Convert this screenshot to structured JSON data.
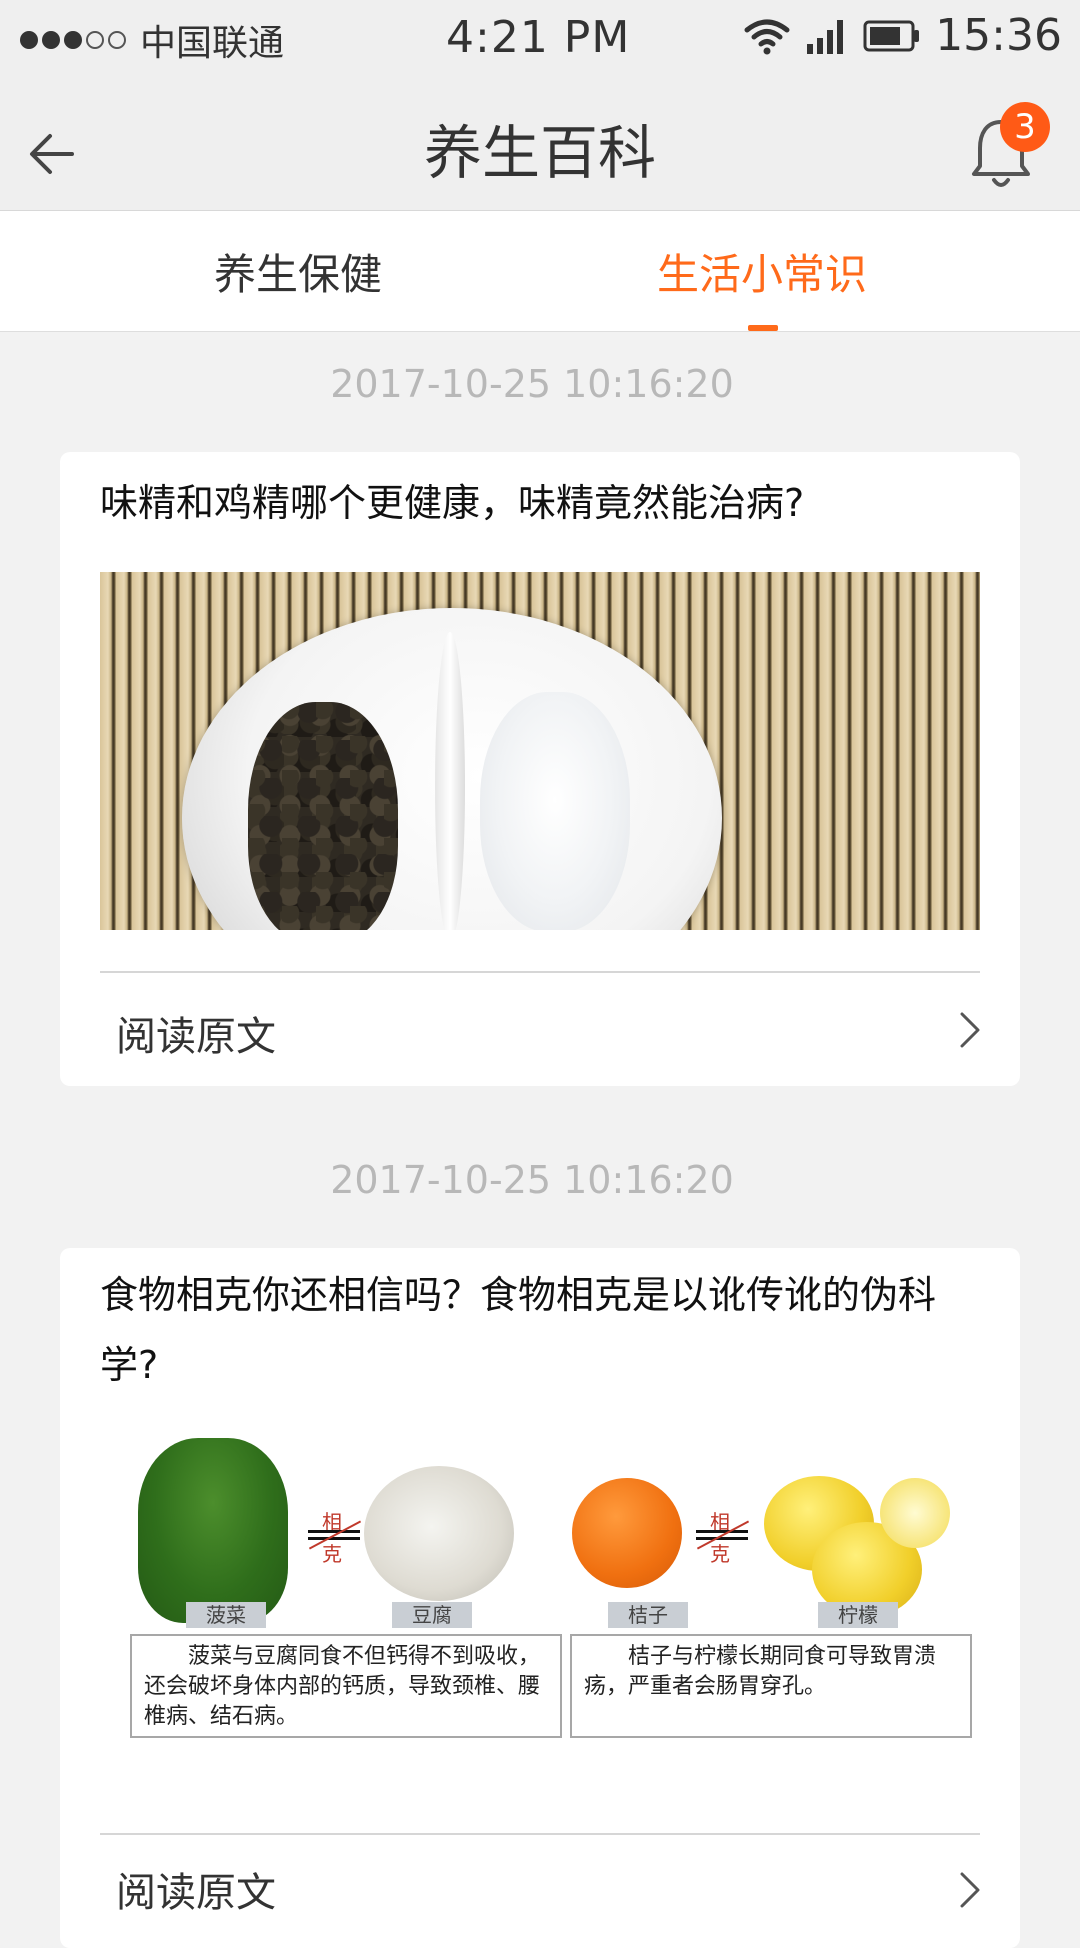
{
  "status_bar": {
    "carrier": "中国联通",
    "center_time": "4:21 PM",
    "time": "15:36"
  },
  "header": {
    "title": "养生百科",
    "notification_count": "3"
  },
  "tabs": [
    {
      "label": "养生保健",
      "active": false
    },
    {
      "label": "生活小常识",
      "active": true
    }
  ],
  "feed": [
    {
      "date": "2017-10-25  10:16:20",
      "title": "味精和鸡精哪个更健康，味精竟然能治病?",
      "read_more": "阅读原文"
    },
    {
      "date": "2017-10-25  10:16:20",
      "title": "食物相克你还相信吗？食物相克是以讹传讹的伪科学?",
      "read_more": "阅读原文",
      "image": {
        "xiangke_top": "相",
        "xiangke_bottom": "克",
        "labels": [
          "菠菜",
          "豆腐",
          "桔子",
          "柠檬"
        ],
        "notes": [
          "菠菜与豆腐同食不但钙得不到吸收，还会破坏身体内部的钙质，导致颈椎、腰椎病、结石病。",
          "桔子与柠檬长期同食可导致胃溃疡，严重者会肠胃穿孔。"
        ]
      }
    }
  ],
  "colors": {
    "accent": "#ff6a1a",
    "badge": "#ff5a16",
    "background": "#f2f2f2"
  },
  "icons": {
    "back": "arrow-left-icon",
    "bell": "bell-icon",
    "chevron": "chevron-right-icon",
    "wifi": "wifi-icon",
    "signal": "signal-icon",
    "battery": "battery-icon"
  }
}
